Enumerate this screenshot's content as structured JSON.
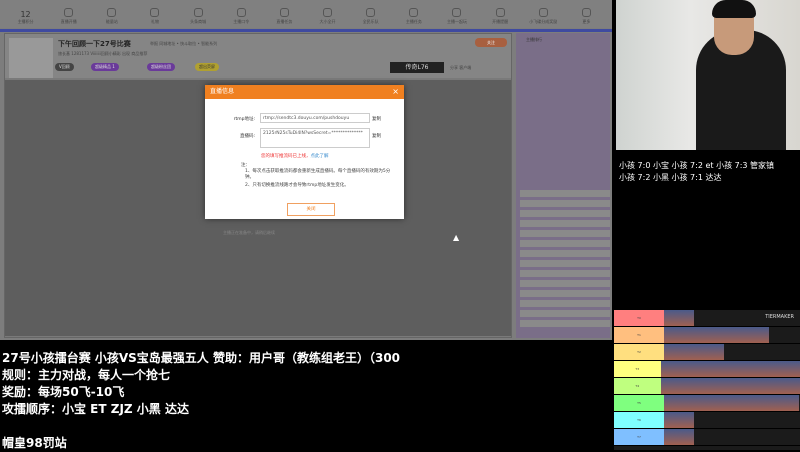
{
  "nav": {
    "count": "12",
    "items": [
      "主播积分",
      "直播开播",
      "能量站",
      "礼物",
      "头条商城",
      "主播口令",
      "直播任务",
      "大小全开",
      "全民乐队",
      "主播任务",
      "主播一起玩",
      "开播提醒",
      "小飞碟分成奖励",
      "更多"
    ]
  },
  "room": {
    "title": "下午回顾一下27号比赛",
    "sub1": "举报  同城地址 • 快斗取拉 • 智能系列",
    "sub2": "旅长基  1281173  Viiiiiii回顾小精彩  出现  商品推荐",
    "pills": [
      "V回顾",
      "超级精品 1",
      "超级粉丝团",
      "超出荧屏"
    ],
    "badge": "传奇L76",
    "follow": "关注",
    "share": "分享  客户端",
    "hint": "主播正在准备中，请稍后继续",
    "sidebar_title": "主播排行"
  },
  "dialog": {
    "title": "直播信息",
    "close": "×",
    "rtmp_label": "rtmp地址:",
    "rtmp_value": "rtmp://sendtc3.douyu.com/pushdouyu",
    "code_label": "直播码:",
    "code_value": "2125rN25sTuDi4lN?wsSecret=**************",
    "copy": "复制",
    "warn": "您的填写推流码已上线，",
    "learn": "点此了解",
    "note_title": "注：",
    "note1": "1、每次点击获取推流码都会重新生成直播码。每个直播码的有效期为5分钟。",
    "note2": "2、只有切换推流线路才会导致rtmp地址发生变化。",
    "close_button": "关闭"
  },
  "scores": {
    "line1": "小孩 7:0 小宝  小孩 7:2 et  小孩 7:3 管家镇",
    "line2": "小孩 7:2 小黑  小孩 7:1 达达"
  },
  "overlay": {
    "line1": " 27号小孩擂台赛  小孩VS宝岛最强五人 赞助：用户哥（教练组老王）（300",
    "line2": "规则：主力对战，每人一个抢七",
    "line3": "奖励：每场50飞-10飞",
    "line4": "攻擂顺序：小宝 ET ZJZ 小黑 达达",
    "line5": "帽皇98罚站"
  },
  "tier": {
    "brand": "TIERMAKER",
    "rows": [
      {
        "label": "T0",
        "color": "#ff7f7f",
        "count": 2
      },
      {
        "label": "T1",
        "color": "#ffbf7f",
        "count": 7
      },
      {
        "label": "T2",
        "color": "#ffdf7f",
        "count": 4
      },
      {
        "label": "T3",
        "color": "#ffff7f",
        "count": 10
      },
      {
        "label": "T4",
        "color": "#bfff7f",
        "count": 10
      },
      {
        "label": "T5",
        "color": "#7fff7f",
        "count": 9
      },
      {
        "label": "T6",
        "color": "#7fffff",
        "count": 2
      },
      {
        "label": "T7",
        "color": "#7fbfff",
        "count": 2
      }
    ]
  }
}
